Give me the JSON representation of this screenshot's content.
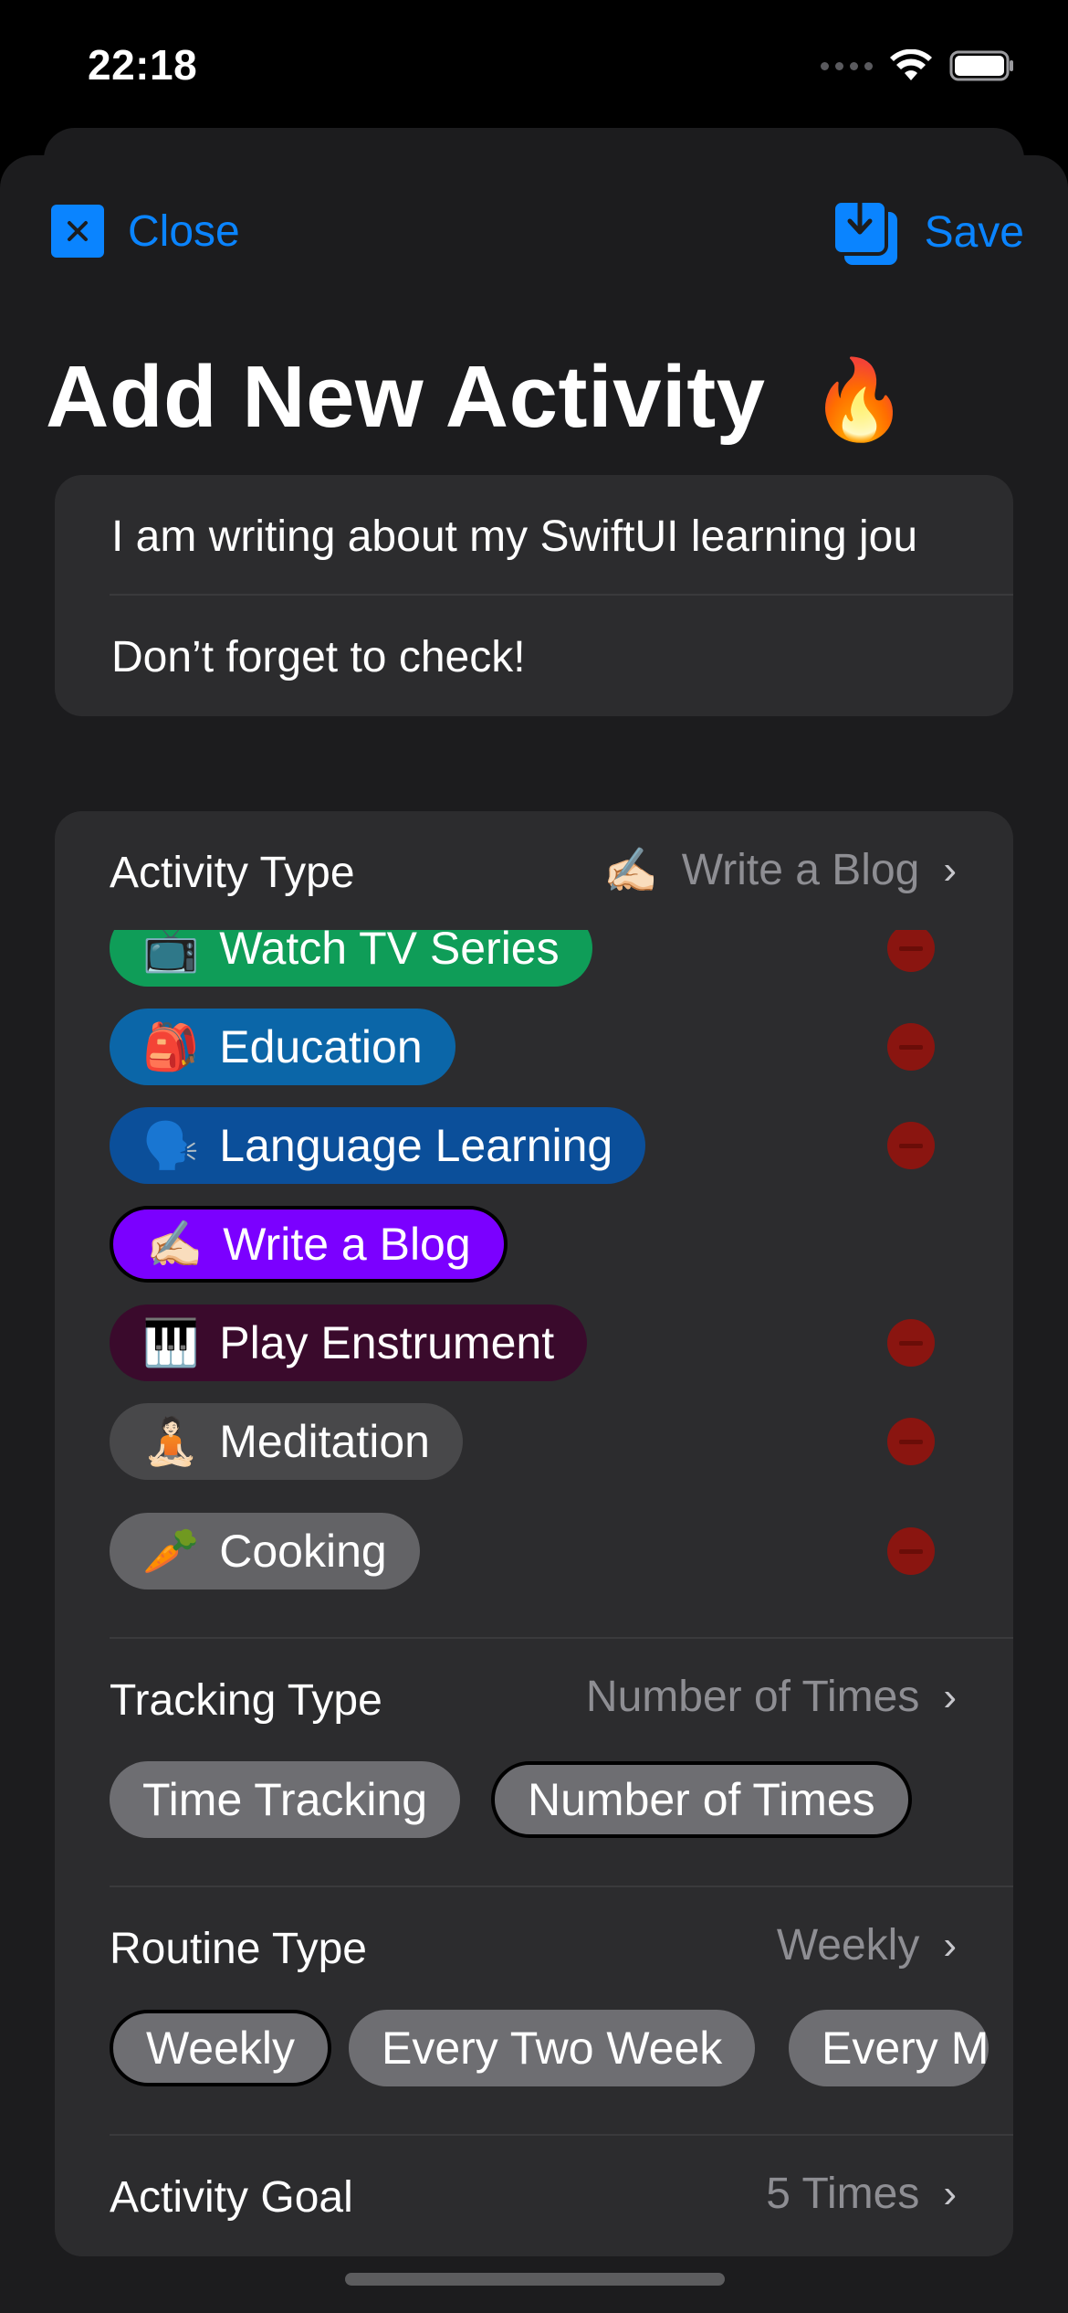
{
  "status_bar": {
    "time": "22:18"
  },
  "toolbar": {
    "close_label": "Close",
    "save_label": "Save"
  },
  "title": {
    "text": "Add New Activity",
    "emoji": "🔥"
  },
  "inputs": {
    "description": "I am writing about my SwiftUI learning jou",
    "reminder": "Don’t forget to check!"
  },
  "activity_type": {
    "label": "Activity Type",
    "value_emoji": "✍🏻",
    "value": "Write a Blog",
    "options": [
      {
        "emoji": "📺",
        "label": "Watch TV Series",
        "color": "#0f9d58",
        "selected": false
      },
      {
        "emoji": "🎒",
        "label": "Education",
        "color": "#0b66a8",
        "selected": false
      },
      {
        "emoji": "🗣️",
        "label": "Language Learning",
        "color": "#0b4f9a",
        "selected": false
      },
      {
        "emoji": "✍🏻",
        "label": "Write a Blog",
        "color": "#7b00ff",
        "selected": true
      },
      {
        "emoji": "🎹",
        "label": "Play Enstrument",
        "color": "#3a0a2c",
        "selected": false
      },
      {
        "emoji": "🧘🏻",
        "label": "Meditation",
        "color": "#48484a",
        "selected": false
      },
      {
        "emoji": "🥕",
        "label": "Cooking",
        "color": "#636366",
        "selected": false
      }
    ]
  },
  "tracking_type": {
    "label": "Tracking Type",
    "value": "Number of Times",
    "options": [
      "Time Tracking",
      "Number of Times"
    ]
  },
  "routine_type": {
    "label": "Routine Type",
    "value": "Weekly",
    "options": [
      "Weekly",
      "Every Two Week",
      "Every M"
    ]
  },
  "activity_goal": {
    "label": "Activity Goal",
    "value": "5 Times"
  }
}
